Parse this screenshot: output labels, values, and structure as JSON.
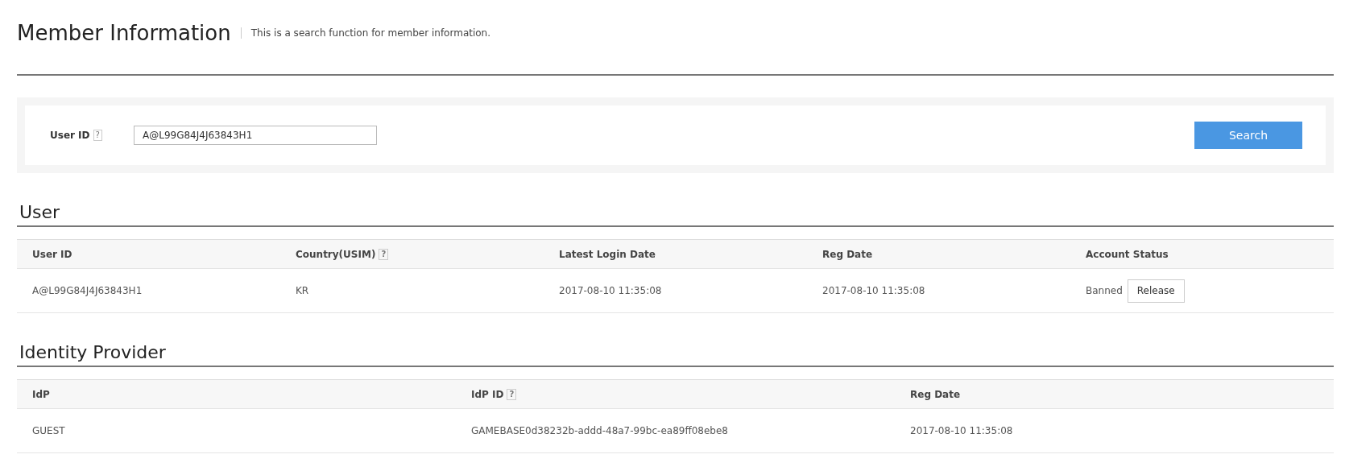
{
  "header": {
    "title": "Member Information",
    "description": "This is a search function for member information."
  },
  "search": {
    "label": "User ID",
    "help": "?",
    "value": "A@L99G84J4J63843H1",
    "button": "Search"
  },
  "sections": [
    {
      "title": "User",
      "columns": [
        {
          "label": "User ID"
        },
        {
          "label": "Country(USIM)",
          "help": "?"
        },
        {
          "label": "Latest Login Date"
        },
        {
          "label": "Reg Date"
        },
        {
          "label": "Account Status"
        }
      ],
      "rows": [
        [
          {
            "kind": "text",
            "text": "A@L99G84J4J63843H1"
          },
          {
            "kind": "text",
            "text": "KR"
          },
          {
            "kind": "text",
            "text": "2017-08-10 11:35:08"
          },
          {
            "kind": "text",
            "text": "2017-08-10 11:35:08"
          },
          {
            "kind": "status",
            "text": "Banned",
            "button": "Release"
          }
        ]
      ]
    },
    {
      "title": "Identity Provider",
      "columns": [
        {
          "label": "IdP"
        },
        {
          "label": "IdP ID",
          "help": "?"
        },
        {
          "label": "Reg Date"
        }
      ],
      "rows": [
        [
          {
            "kind": "text",
            "text": "GUEST"
          },
          {
            "kind": "text",
            "text": "GAMEBASE0d38232b-addd-48a7-99bc-ea89ff08ebe8"
          },
          {
            "kind": "text",
            "text": "2017-08-10 11:35:08"
          }
        ]
      ]
    }
  ]
}
